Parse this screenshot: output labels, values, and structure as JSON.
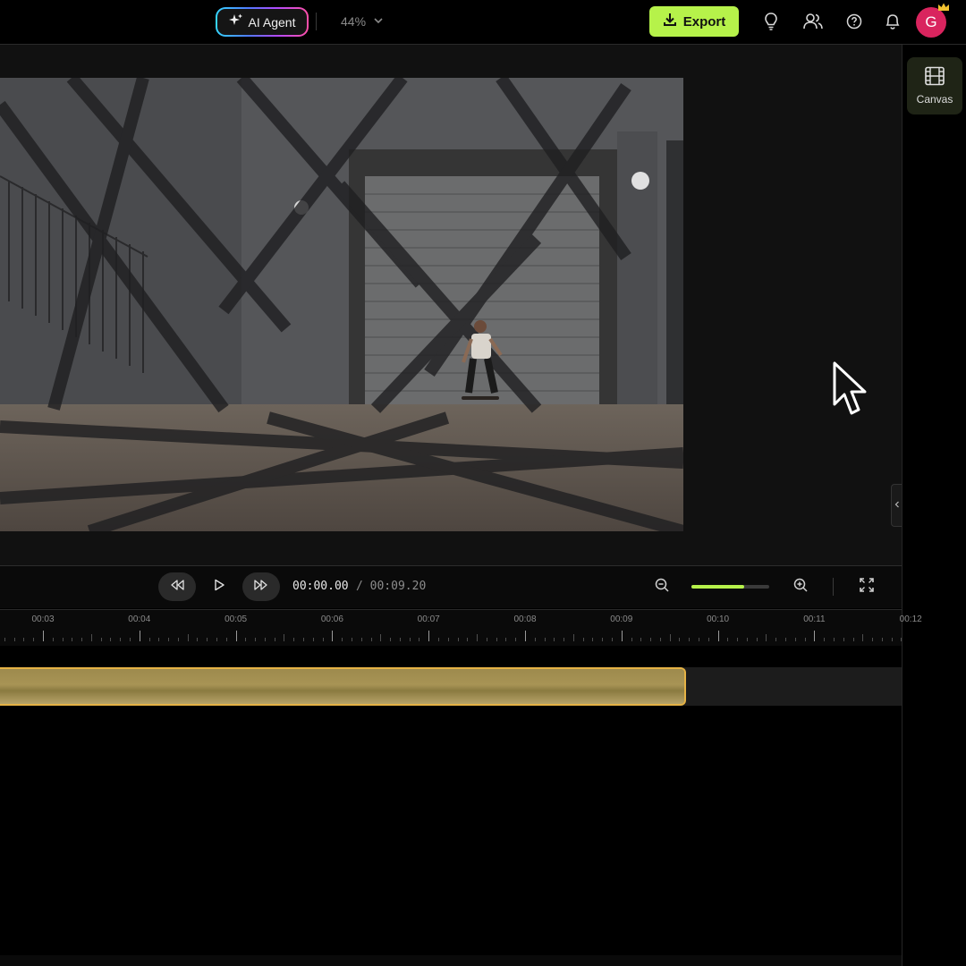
{
  "topbar": {
    "ai_agent_label": "AI Agent",
    "zoom_value": "44%",
    "export_label": "Export",
    "avatar_initial": "G"
  },
  "right_panel": {
    "canvas_label": "Canvas"
  },
  "playback": {
    "current_time": "00:00.00",
    "total_time": "/ 00:09.20",
    "timeline_zoom_fraction": 0.68
  },
  "ruler": {
    "labels": [
      "00:03",
      "00:04",
      "00:05",
      "00:06",
      "00:07",
      "00:08",
      "00:09",
      "00:10",
      "00:11",
      "00:12"
    ]
  },
  "colors": {
    "accent": "#b6f24a",
    "clip_border": "#e5b245",
    "avatar": "#d9245e"
  }
}
